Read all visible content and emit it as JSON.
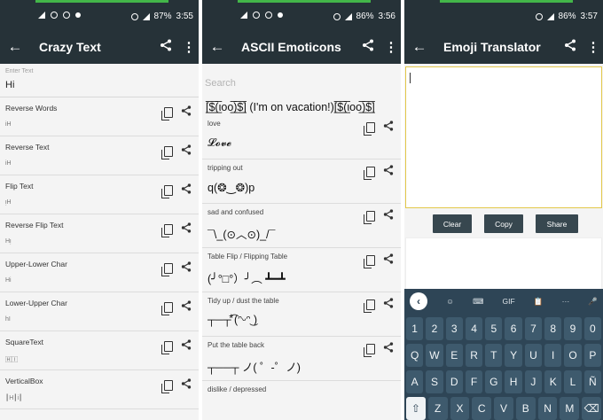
{
  "status": [
    {
      "battery": "87%",
      "time": "3:55"
    },
    {
      "battery": "86%",
      "time": "3:56"
    },
    {
      "battery": "86%",
      "time": "3:57"
    }
  ],
  "crazy": {
    "title": "Crazy Text",
    "enter_label": "Enter Text",
    "enter_value": "Hi",
    "items": [
      {
        "label": "Reverse Words",
        "output": "iH"
      },
      {
        "label": "Reverse Text",
        "output": "iH"
      },
      {
        "label": "Flip Text",
        "output": "ᴉH"
      },
      {
        "label": "Reverse Flip Text",
        "output": "Hᴉ"
      },
      {
        "label": "Upper-Lower Char",
        "output": "Hi"
      },
      {
        "label": "Lower-Upper Char",
        "output": "hI"
      },
      {
        "label": "SquareText",
        "output": "🄷🄸"
      },
      {
        "label": "VerticalBox",
        "output": "┃H┃i┃"
      }
    ]
  },
  "ascii": {
    "title": "ASCII Emoticons",
    "search_placeholder": "Search",
    "header_text": "[̲̅$̲̅(̲̅ιοο̲̅)̲̅$̲̅] (I'm on vacation!)[̲̅$̲̅(̲̅ιοο̲̅)̲̅$̲̅]",
    "items": [
      {
        "label": "love",
        "output": "𝓛𝓸𝓿𝓮"
      },
      {
        "label": "tripping out",
        "output": "q(❂‿❂)p"
      },
      {
        "label": "sad and confused",
        "output": "¯\\_(⊙︿⊙)_/¯"
      },
      {
        "label": "Table Flip / Flipping Table",
        "output": "(╯°□°）╯︵ ┻━┻"
      },
      {
        "label": "Tidy up / dust the table",
        "output": "┬─┬⃰͡ (ᵔᵕᵔ͜ )"
      },
      {
        "label": "Put the table back",
        "output": "┬──┬ ノ( ゜-゜ノ)"
      },
      {
        "label": "dislike / depressed",
        "output": ""
      }
    ]
  },
  "emoji": {
    "title": "Emoji Translator",
    "buttons": {
      "clear": "Clear",
      "copy": "Copy",
      "share": "Share"
    },
    "keyboard": {
      "toolbar": [
        "☺",
        "⌨",
        "GIF",
        "📋",
        "···",
        "🎤"
      ],
      "gif": "GIF",
      "more": "···",
      "row_numbers": [
        "1",
        "2",
        "3",
        "4",
        "5",
        "6",
        "7",
        "8",
        "9",
        "0"
      ],
      "row1": [
        "Q",
        "W",
        "E",
        "R",
        "T",
        "Y",
        "U",
        "I",
        "O",
        "P"
      ],
      "row2": [
        "A",
        "S",
        "D",
        "F",
        "G",
        "H",
        "J",
        "K",
        "L",
        "Ñ"
      ],
      "row3": [
        "⇧",
        "Z",
        "X",
        "C",
        "V",
        "B",
        "N",
        "M",
        "⌫"
      ]
    }
  }
}
